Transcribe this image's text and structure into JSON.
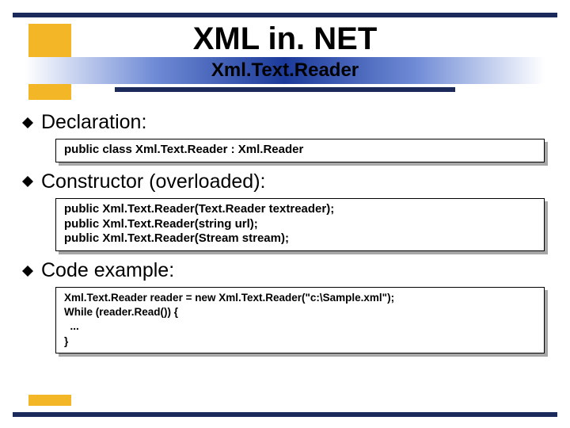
{
  "colors": {
    "navy": "#1b2a5b",
    "yellow": "#f3b626",
    "gradient_mid": "#1b3a9a"
  },
  "title": "XML in. NET",
  "subtitle": "Xml.Text.Reader",
  "sections": [
    {
      "heading": "Declaration:",
      "code": "public class Xml.Text.Reader : Xml.Reader"
    },
    {
      "heading": "Constructor (overloaded):",
      "code": "public Xml.Text.Reader(Text.Reader textreader);\npublic Xml.Text.Reader(string url);\npublic Xml.Text.Reader(Stream stream);"
    },
    {
      "heading": "Code example:",
      "code": "Xml.Text.Reader reader = new Xml.Text.Reader(\"c:\\Sample.xml\");\nWhile (reader.Read()) {\n  ...\n}"
    }
  ]
}
